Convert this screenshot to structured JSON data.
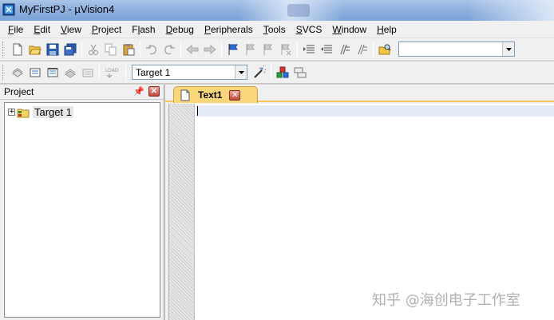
{
  "window": {
    "title": "MyFirstPJ  - µVision4"
  },
  "menu": {
    "items": [
      {
        "key": "F",
        "rest": "ile"
      },
      {
        "key": "E",
        "rest": "dit"
      },
      {
        "key": "V",
        "rest": "iew"
      },
      {
        "key": "P",
        "rest": "roject"
      },
      {
        "key": "F",
        "rest": "lash",
        "pre": ""
      },
      {
        "key": "D",
        "rest": "ebug"
      },
      {
        "key": "P",
        "rest": "eripherals"
      },
      {
        "key": "T",
        "rest": "ools"
      },
      {
        "key": "S",
        "rest": "VCS"
      },
      {
        "key": "W",
        "rest": "indow"
      },
      {
        "key": "H",
        "rest": "elp"
      }
    ]
  },
  "toolbar2": {
    "target_select": "Target 1",
    "load_label": "LOAD"
  },
  "project_panel": {
    "title": "Project",
    "root_item": "Target 1"
  },
  "editor": {
    "tab_label": "Text1"
  },
  "watermark": "知乎 @海创电子工作室"
}
